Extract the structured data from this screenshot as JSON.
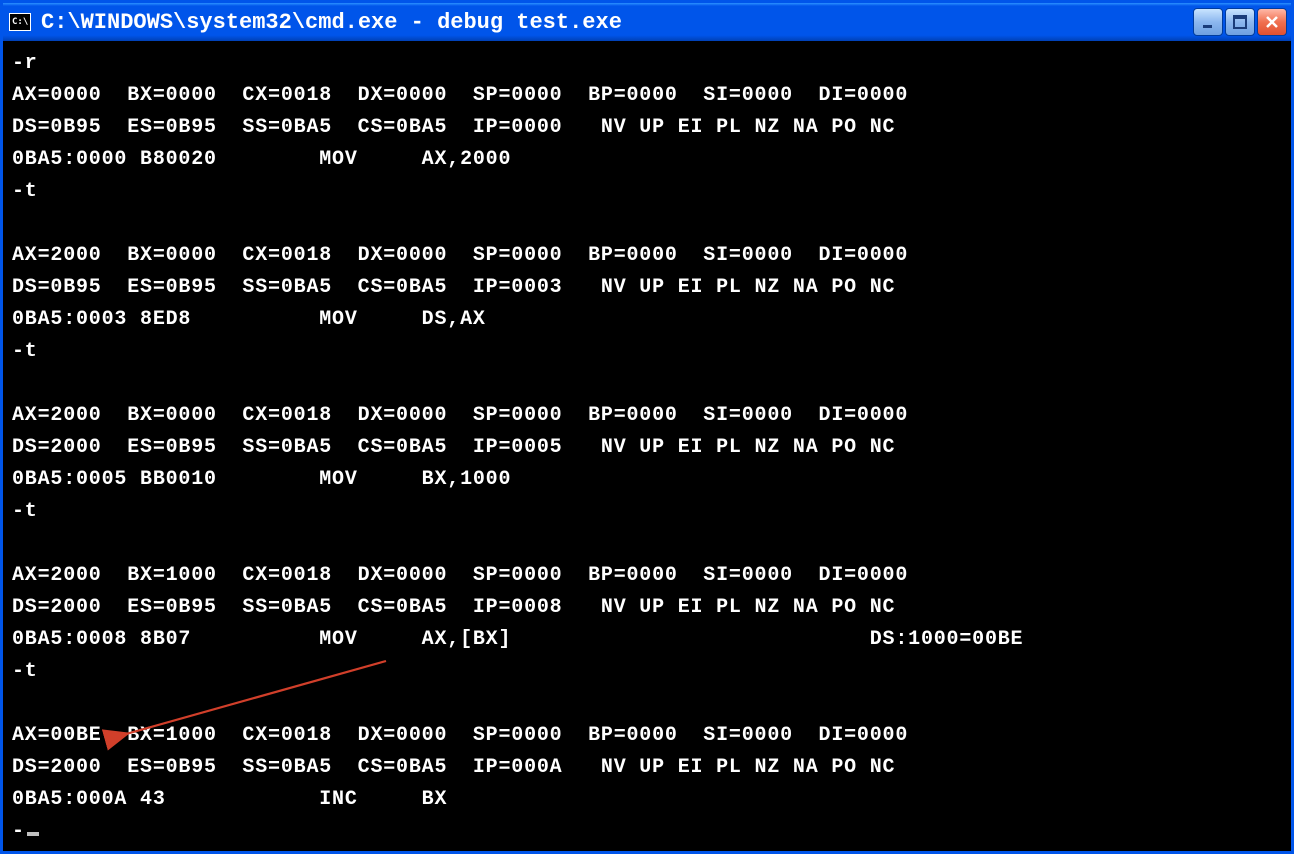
{
  "window": {
    "title": "C:\\WINDOWS\\system32\\cmd.exe - debug test.exe",
    "icon_label": "C:\\"
  },
  "terminal": {
    "blocks": [
      {
        "prompt": "-r",
        "regs1": "AX=0000  BX=0000  CX=0018  DX=0000  SP=0000  BP=0000  SI=0000  DI=0000",
        "regs2": "DS=0B95  ES=0B95  SS=0BA5  CS=0BA5  IP=0000   NV UP EI PL NZ NA PO NC",
        "disasm": "0BA5:0000 B80020        MOV     AX,2000"
      },
      {
        "prompt": "-t",
        "regs1": "AX=2000  BX=0000  CX=0018  DX=0000  SP=0000  BP=0000  SI=0000  DI=0000",
        "regs2": "DS=0B95  ES=0B95  SS=0BA5  CS=0BA5  IP=0003   NV UP EI PL NZ NA PO NC",
        "disasm": "0BA5:0003 8ED8          MOV     DS,AX"
      },
      {
        "prompt": "-t",
        "regs1": "AX=2000  BX=0000  CX=0018  DX=0000  SP=0000  BP=0000  SI=0000  DI=0000",
        "regs2": "DS=2000  ES=0B95  SS=0BA5  CS=0BA5  IP=0005   NV UP EI PL NZ NA PO NC",
        "disasm": "0BA5:0005 BB0010        MOV     BX,1000"
      },
      {
        "prompt": "-t",
        "regs1": "AX=2000  BX=1000  CX=0018  DX=0000  SP=0000  BP=0000  SI=0000  DI=0000",
        "regs2": "DS=2000  ES=0B95  SS=0BA5  CS=0BA5  IP=0008   NV UP EI PL NZ NA PO NC",
        "disasm": "0BA5:0008 8B07          MOV     AX,[BX]                            DS:1000=00BE"
      },
      {
        "prompt": "-t",
        "regs1": "AX=00BE  BX=1000  CX=0018  DX=0000  SP=0000  BP=0000  SI=0000  DI=0000",
        "regs2": "DS=2000  ES=0B95  SS=0BA5  CS=0BA5  IP=000A   NV UP EI PL NZ NA PO NC",
        "disasm": "0BA5:000A 43            INC     BX"
      }
    ],
    "final_prompt": "-"
  },
  "annotation": {
    "arrow_color": "#d13f2a"
  }
}
